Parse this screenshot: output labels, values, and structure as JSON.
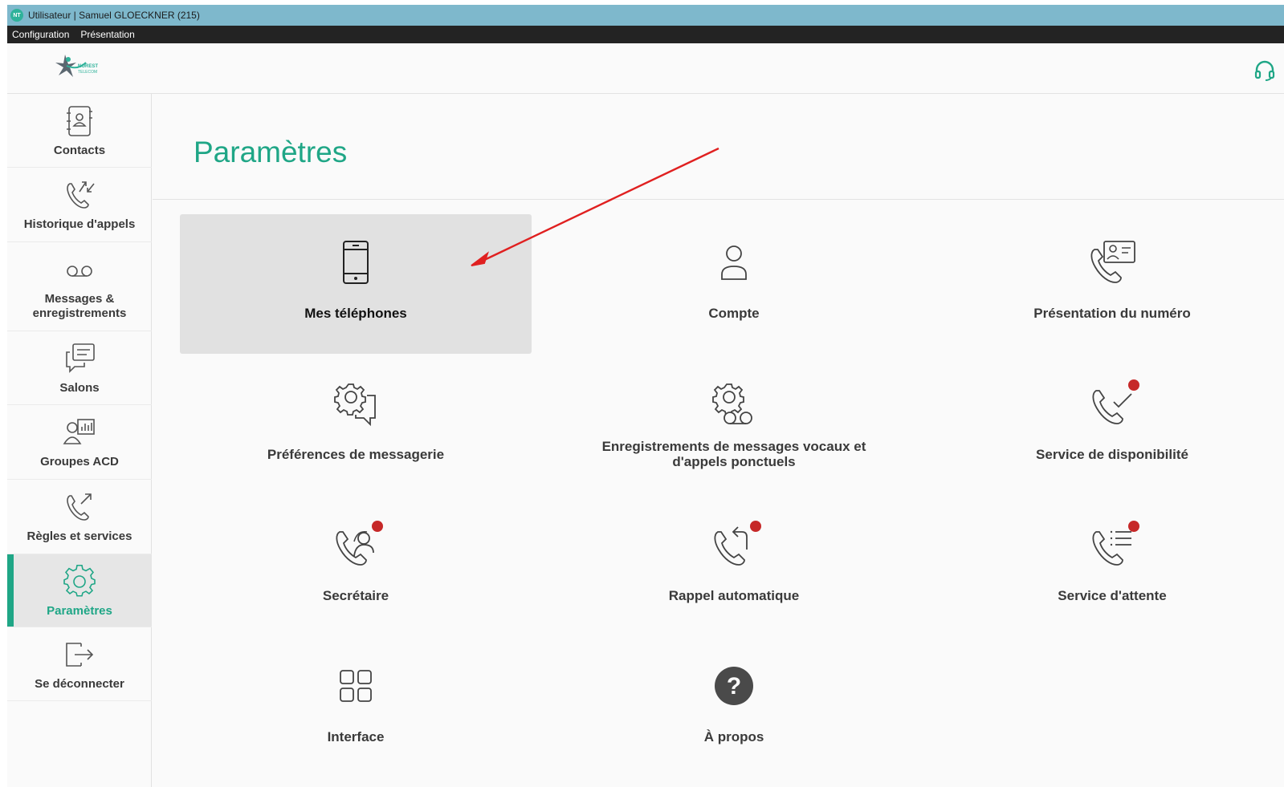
{
  "window": {
    "title": "Utilisateur | Samuel GLOECKNER (215)",
    "app_badge": "NT"
  },
  "menubar": {
    "items": [
      "Configuration",
      "Présentation"
    ]
  },
  "header": {
    "logo_text_line1": "NOREST",
    "logo_text_line2": "TELECOM"
  },
  "sidebar": {
    "items": [
      {
        "label": "Contacts",
        "icon": "contacts-book-icon"
      },
      {
        "label": "Historique d'appels",
        "icon": "call-history-icon"
      },
      {
        "label": "Messages & enregistrements",
        "icon": "voicemail-icon"
      },
      {
        "label": "Salons",
        "icon": "chat-rooms-icon"
      },
      {
        "label": "Groupes ACD",
        "icon": "acd-groups-icon"
      },
      {
        "label": "Règles et services",
        "icon": "call-forward-icon"
      },
      {
        "label": "Paramètres",
        "icon": "gear-icon",
        "active": true
      },
      {
        "label": "Se déconnecter",
        "icon": "logout-icon"
      }
    ]
  },
  "main": {
    "title": "Paramètres",
    "tiles": [
      {
        "label": "Mes téléphones",
        "icon": "mobile-phone-icon",
        "selected": true
      },
      {
        "label": "Compte",
        "icon": "user-icon"
      },
      {
        "label": "Présentation du numéro",
        "icon": "caller-id-icon"
      },
      {
        "label": "Préférences de messagerie",
        "icon": "messaging-settings-icon"
      },
      {
        "label": "Enregistrements de messages vocaux et d'appels ponctuels",
        "icon": "voicemail-settings-icon"
      },
      {
        "label": "Service de disponibilité",
        "icon": "availability-icon",
        "badge": true
      },
      {
        "label": "Secrétaire",
        "icon": "secretary-icon",
        "badge": true
      },
      {
        "label": "Rappel automatique",
        "icon": "auto-callback-icon",
        "badge": true
      },
      {
        "label": "Service d'attente",
        "icon": "queue-service-icon",
        "badge": true
      },
      {
        "label": "Interface",
        "icon": "grid-icon"
      },
      {
        "label": "À propos",
        "icon": "help-icon"
      }
    ]
  },
  "colors": {
    "accent": "#1fa686",
    "titlebar": "#7eb8cc",
    "menubar": "#232323",
    "badge": "#c62828",
    "annotation_arrow": "#e02020"
  }
}
